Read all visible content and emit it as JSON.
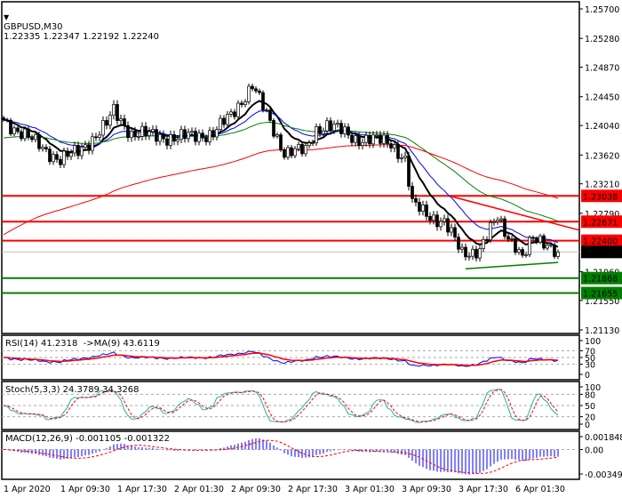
{
  "header": {
    "symbol": "GBPUSD,M30",
    "ohlc": "1.22335 1.22347 1.22192 1.22240"
  },
  "indicators": {
    "rsi": "RSI(14) 41.2318  ->MA(9) 43.6119",
    "stoch": "Stoch(5,3,3) 24.3789 34.3268",
    "macd": "MACD(12,26,9) -0.001105 -0.001322"
  },
  "chart_data": {
    "type": "candlestick",
    "symbol": "GBPUSD",
    "timeframe": "M30",
    "ylim": [
      1.2113,
      1.257
    ],
    "price_ticks": [
      "1.25700",
      "1.25280",
      "1.24870",
      "1.24450",
      "1.24040",
      "1.23620",
      "1.23210",
      "1.22790",
      "1.21960",
      "1.21550",
      "1.21130"
    ],
    "levels": [
      {
        "price": 1.23038,
        "label": "1.23038",
        "color": "#ff0000"
      },
      {
        "price": 1.22671,
        "label": "1.22671",
        "color": "#ff0000"
      },
      {
        "price": 1.224,
        "label": "1.22400",
        "color": "#ff0000"
      },
      {
        "price": 1.21868,
        "label": "1.21868",
        "color": "#008000"
      },
      {
        "price": 1.21655,
        "label": "1.21655",
        "color": "#008000"
      }
    ],
    "current": {
      "price": 1.2224,
      "label": "1.22240"
    },
    "trendlines": [
      {
        "color": "#ff0000",
        "from": [
          126,
          1.2303
        ],
        "to": [
          162,
          1.2255
        ]
      },
      {
        "color": "#008000",
        "from": [
          130,
          1.22
        ],
        "to": [
          156,
          1.2209
        ]
      }
    ],
    "close_path": [
      [
        0,
        1.2412
      ],
      [
        7,
        1.2386
      ],
      [
        16,
        1.2355
      ],
      [
        21,
        1.2367
      ],
      [
        29,
        1.2405
      ],
      [
        31,
        1.2424
      ],
      [
        36,
        1.2393
      ],
      [
        49,
        1.2386
      ],
      [
        59,
        1.2393
      ],
      [
        64,
        1.2418
      ],
      [
        70,
        1.2462
      ],
      [
        74,
        1.2418
      ],
      [
        79,
        1.2367
      ],
      [
        85,
        1.2367
      ],
      [
        88,
        1.2399
      ],
      [
        91,
        1.2405
      ],
      [
        99,
        1.2386
      ],
      [
        109,
        1.238
      ],
      [
        113,
        1.2355
      ],
      [
        115,
        1.2291
      ],
      [
        119,
        1.2279
      ],
      [
        124,
        1.2266
      ],
      [
        129,
        1.2222
      ],
      [
        134,
        1.2228
      ],
      [
        139,
        1.2272
      ],
      [
        141,
        1.2254
      ],
      [
        144,
        1.2235
      ],
      [
        146,
        1.2215
      ],
      [
        149,
        1.2241
      ],
      [
        153,
        1.2238
      ],
      [
        156,
        1.2224
      ]
    ],
    "moving_averages": [
      {
        "color": "#000000",
        "period": 10
      },
      {
        "color": "#0000ff",
        "period": 20
      },
      {
        "color": "#008000",
        "period": 50
      },
      {
        "color": "#ff0000",
        "period": 200
      }
    ],
    "rsi_ticks": [
      "100",
      "70",
      "50",
      "30",
      "0"
    ],
    "stoch_ticks": [
      "100",
      "80",
      "50",
      "20",
      "0"
    ],
    "macd_ticks": [
      "0.001848",
      "0.00",
      "-0.003492"
    ],
    "macd_range": [
      -0.003492,
      0.001848
    ],
    "x_labels": [
      "1 Apr 2020",
      "1 Apr 09:30",
      "1 Apr 17:30",
      "2 Apr 01:30",
      "2 Apr 09:30",
      "2 Apr 17:30",
      "3 Apr 01:30",
      "3 Apr 09:30",
      "3 Apr 17:30",
      "6 Apr 01:30"
    ]
  }
}
